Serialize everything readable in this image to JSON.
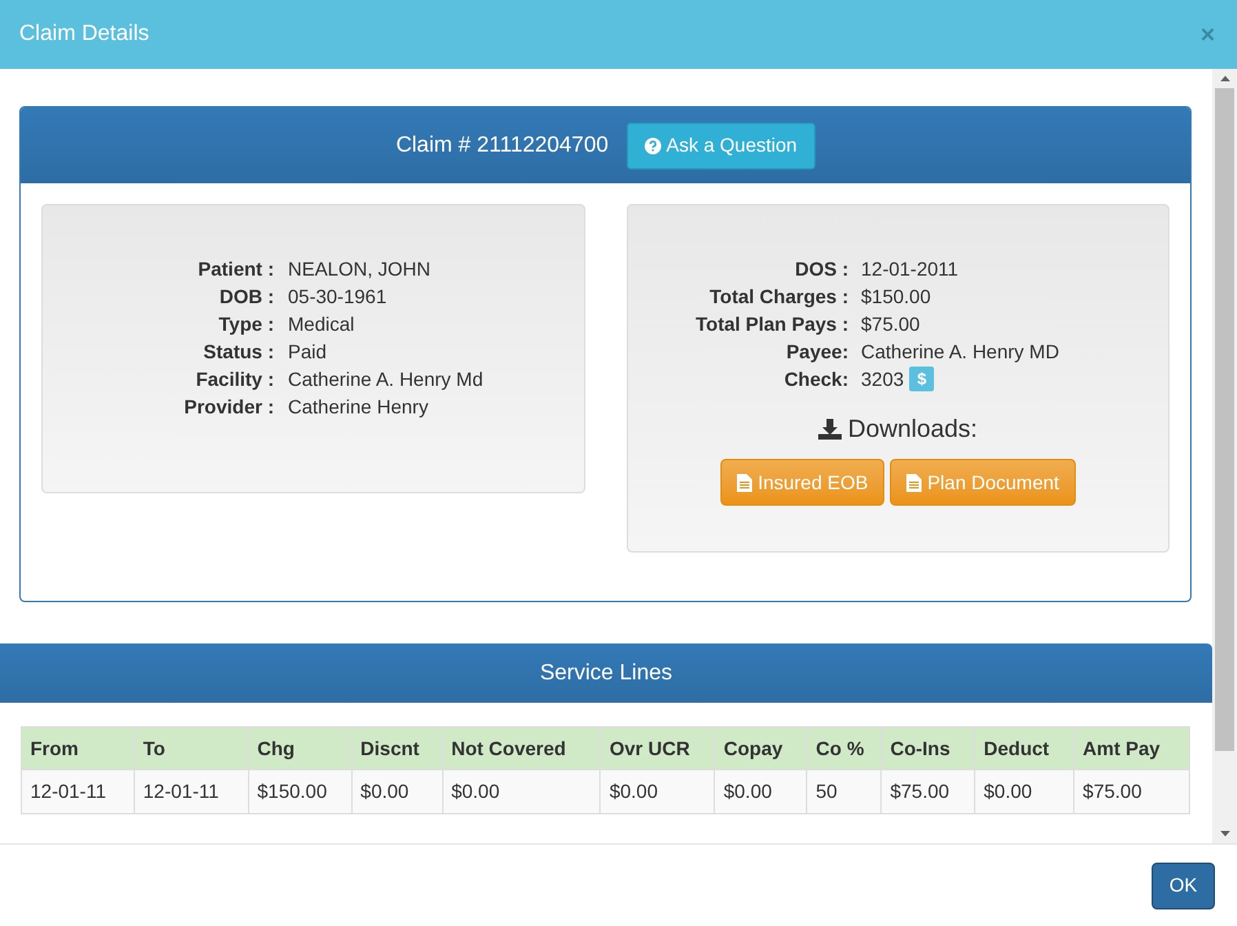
{
  "window": {
    "title": "Claim Details",
    "close": "×"
  },
  "claim": {
    "title": "Claim # 21112204700",
    "ask_button": "Ask a Question",
    "left_fields": [
      {
        "label": "Patient :",
        "value": "NEALON, JOHN"
      },
      {
        "label": "DOB :",
        "value": "05-30-1961"
      },
      {
        "label": "Type :",
        "value": "Medical"
      },
      {
        "label": "Status :",
        "value": "Paid"
      },
      {
        "label": "Facility :",
        "value": "Catherine A. Henry Md"
      },
      {
        "label": "Provider :",
        "value": "Catherine Henry"
      }
    ],
    "right_fields": [
      {
        "label": "DOS :",
        "value": "12-01-2011"
      },
      {
        "label": "Total Charges :",
        "value": "$150.00"
      },
      {
        "label": "Total Plan Pays :",
        "value": "$75.00"
      },
      {
        "label": "Payee:",
        "value": "Catherine A. Henry MD"
      },
      {
        "label": "Check:",
        "value": "3203",
        "badge": "$"
      }
    ],
    "downloads_label": "Downloads:",
    "download_buttons": [
      "Insured EOB",
      "Plan Document"
    ]
  },
  "service_lines": {
    "title": "Service Lines",
    "columns": [
      "From",
      "To",
      "Chg",
      "Discnt",
      "Not Covered",
      "Ovr UCR",
      "Copay",
      "Co %",
      "Co-Ins",
      "Deduct",
      "Amt Pay"
    ],
    "rows": [
      [
        "12-01-11",
        "12-01-11",
        "$150.00",
        "$0.00",
        "$0.00",
        "$0.00",
        "$0.00",
        "50",
        "$75.00",
        "$0.00",
        "$75.00"
      ]
    ]
  },
  "footer": {
    "ok_button": "OK"
  }
}
